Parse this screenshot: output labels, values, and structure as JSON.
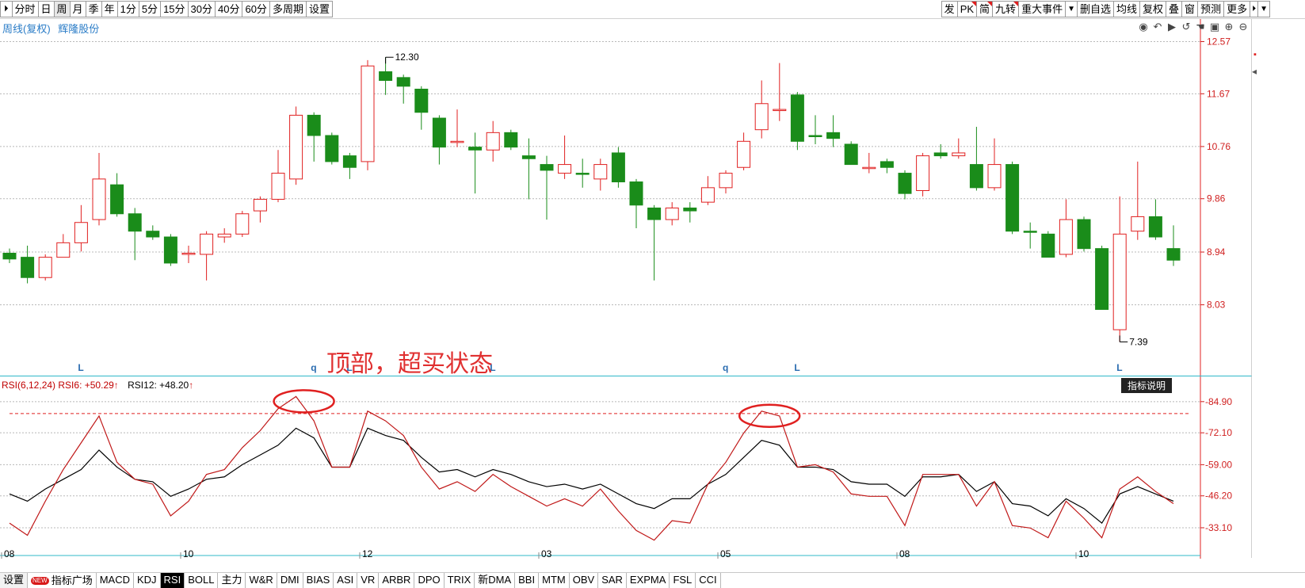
{
  "toolbar": {
    "left_icon": "⏵",
    "left_items": [
      {
        "label": "分时",
        "active": false
      },
      {
        "label": "日",
        "active": false
      },
      {
        "label": "周",
        "active": true
      },
      {
        "label": "月",
        "active": false
      },
      {
        "label": "季",
        "active": false
      },
      {
        "label": "年",
        "active": false
      },
      {
        "label": "1分",
        "active": false
      },
      {
        "label": "5分",
        "active": false
      },
      {
        "label": "15分",
        "active": false
      },
      {
        "label": "30分",
        "active": false
      },
      {
        "label": "40分",
        "active": false
      },
      {
        "label": "60分",
        "active": false
      },
      {
        "label": "多周期",
        "active": false
      },
      {
        "label": "设置",
        "active": false
      }
    ],
    "right_items": [
      "发",
      "PK",
      "简",
      "九转",
      "重大事件",
      "▼",
      "删自选",
      "均线",
      "复权",
      "叠",
      "窗",
      "预测",
      "更多",
      "⏵",
      "▼"
    ]
  },
  "chart": {
    "title_period": "周线(复权)",
    "title_stock": "辉隆股份",
    "high_label": "12.30",
    "low_label": "7.39",
    "annotation": "顶部，超买状态",
    "price_ticks": [
      "12.57",
      "11.67",
      "10.76",
      "9.86",
      "8.94",
      "8.03"
    ],
    "price_min": 7.15,
    "price_max": 12.85,
    "signal_marks": [
      {
        "label": "L",
        "index": 4
      },
      {
        "label": "q",
        "index": 17
      },
      {
        "label": "L",
        "index": 19
      },
      {
        "label": "L",
        "index": 27
      },
      {
        "label": "q",
        "index": 40
      },
      {
        "label": "L",
        "index": 44
      },
      {
        "label": "L",
        "index": 62
      }
    ],
    "colors": {
      "up": "#e02020",
      "down": "#1a8c1a",
      "rsi6": "#c01818",
      "rsi12": "#000000",
      "grid": "#b8b8b8"
    }
  },
  "rsi": {
    "legend_name": "RSI(6,12,24)",
    "rsi6_label": "RSI6:",
    "rsi6_value": "+50.29",
    "rsi12_label": "RSI12:",
    "rsi12_value": "+48.20",
    "up_arrow": "↑",
    "help_label": "指标说明",
    "ticks": [
      "84.90",
      "72.10",
      "59.00",
      "46.20",
      "33.10"
    ],
    "overbought": 80,
    "x_labels": [
      {
        "label": "08",
        "index": 0
      },
      {
        "label": "10",
        "index": 10
      },
      {
        "label": "12",
        "index": 20
      },
      {
        "label": "03",
        "index": 30
      },
      {
        "label": "05",
        "index": 40
      },
      {
        "label": "08",
        "index": 50
      },
      {
        "label": "10",
        "index": 60
      }
    ]
  },
  "chart_data": {
    "type": "candlestick",
    "title": "周线(复权) 辉隆股份",
    "candles": [
      {
        "o": 8.82,
        "c": 8.92,
        "h": 9.0,
        "l": 8.75,
        "up": false
      },
      {
        "o": 8.85,
        "c": 8.5,
        "h": 9.05,
        "l": 8.4,
        "up": false
      },
      {
        "o": 8.5,
        "c": 8.85,
        "h": 8.9,
        "l": 8.45,
        "up": true
      },
      {
        "o": 8.85,
        "c": 9.1,
        "h": 9.25,
        "l": 8.85,
        "up": true
      },
      {
        "o": 9.1,
        "c": 9.45,
        "h": 9.75,
        "l": 8.95,
        "up": true
      },
      {
        "o": 9.5,
        "c": 10.2,
        "h": 10.65,
        "l": 9.4,
        "up": true
      },
      {
        "o": 10.1,
        "c": 9.6,
        "h": 10.3,
        "l": 9.55,
        "up": false
      },
      {
        "o": 9.6,
        "c": 9.3,
        "h": 9.7,
        "l": 8.8,
        "up": false
      },
      {
        "o": 9.3,
        "c": 9.2,
        "h": 9.4,
        "l": 9.15,
        "up": false
      },
      {
        "o": 9.2,
        "c": 8.75,
        "h": 9.25,
        "l": 8.7,
        "up": false
      },
      {
        "o": 8.9,
        "c": 8.92,
        "h": 9.05,
        "l": 8.75,
        "up": true
      },
      {
        "o": 8.9,
        "c": 9.25,
        "h": 9.3,
        "l": 8.45,
        "up": true
      },
      {
        "o": 9.2,
        "c": 9.25,
        "h": 9.35,
        "l": 9.1,
        "up": true
      },
      {
        "o": 9.25,
        "c": 9.6,
        "h": 9.65,
        "l": 9.2,
        "up": true
      },
      {
        "o": 9.65,
        "c": 9.85,
        "h": 9.9,
        "l": 9.45,
        "up": true
      },
      {
        "o": 9.85,
        "c": 10.3,
        "h": 10.7,
        "l": 9.8,
        "up": true
      },
      {
        "o": 10.2,
        "c": 11.3,
        "h": 11.45,
        "l": 10.1,
        "up": true
      },
      {
        "o": 11.3,
        "c": 10.95,
        "h": 11.35,
        "l": 10.5,
        "up": false
      },
      {
        "o": 10.95,
        "c": 10.5,
        "h": 11.0,
        "l": 10.45,
        "up": false
      },
      {
        "o": 10.6,
        "c": 10.4,
        "h": 10.65,
        "l": 10.2,
        "up": false
      },
      {
        "o": 10.5,
        "c": 12.15,
        "h": 12.25,
        "l": 10.35,
        "up": true
      },
      {
        "o": 12.05,
        "c": 11.9,
        "h": 12.3,
        "l": 11.65,
        "up": false
      },
      {
        "o": 11.95,
        "c": 11.8,
        "h": 12.0,
        "l": 11.5,
        "up": false
      },
      {
        "o": 11.75,
        "c": 11.35,
        "h": 11.8,
        "l": 11.05,
        "up": false
      },
      {
        "o": 11.25,
        "c": 10.75,
        "h": 11.3,
        "l": 10.45,
        "up": false
      },
      {
        "o": 10.85,
        "c": 10.85,
        "h": 11.4,
        "l": 10.75,
        "up": true
      },
      {
        "o": 10.75,
        "c": 10.7,
        "h": 11.0,
        "l": 9.95,
        "up": false
      },
      {
        "o": 10.7,
        "c": 11.0,
        "h": 11.2,
        "l": 10.5,
        "up": true
      },
      {
        "o": 11.0,
        "c": 10.75,
        "h": 11.05,
        "l": 10.7,
        "up": false
      },
      {
        "o": 10.6,
        "c": 10.55,
        "h": 10.9,
        "l": 9.85,
        "up": false
      },
      {
        "o": 10.45,
        "c": 10.35,
        "h": 10.6,
        "l": 9.5,
        "up": false
      },
      {
        "o": 10.3,
        "c": 10.45,
        "h": 10.95,
        "l": 10.2,
        "up": true
      },
      {
        "o": 10.3,
        "c": 10.3,
        "h": 10.55,
        "l": 10.05,
        "up": false
      },
      {
        "o": 10.2,
        "c": 10.45,
        "h": 10.55,
        "l": 10.0,
        "up": true
      },
      {
        "o": 10.65,
        "c": 10.15,
        "h": 10.75,
        "l": 10.05,
        "up": false
      },
      {
        "o": 10.15,
        "c": 9.75,
        "h": 10.2,
        "l": 9.35,
        "up": false
      },
      {
        "o": 9.7,
        "c": 9.5,
        "h": 9.75,
        "l": 8.45,
        "up": false
      },
      {
        "o": 9.5,
        "c": 9.7,
        "h": 9.8,
        "l": 9.4,
        "up": true
      },
      {
        "o": 9.7,
        "c": 9.65,
        "h": 9.8,
        "l": 9.45,
        "up": false
      },
      {
        "o": 9.8,
        "c": 10.05,
        "h": 10.25,
        "l": 9.75,
        "up": true
      },
      {
        "o": 10.05,
        "c": 10.3,
        "h": 10.35,
        "l": 9.95,
        "up": true
      },
      {
        "o": 10.4,
        "c": 10.85,
        "h": 11.0,
        "l": 10.35,
        "up": true
      },
      {
        "o": 11.05,
        "c": 11.5,
        "h": 11.9,
        "l": 10.9,
        "up": true
      },
      {
        "o": 11.4,
        "c": 11.4,
        "h": 12.2,
        "l": 11.2,
        "up": true
      },
      {
        "o": 11.65,
        "c": 10.85,
        "h": 11.7,
        "l": 10.7,
        "up": false
      },
      {
        "o": 10.95,
        "c": 10.95,
        "h": 11.3,
        "l": 10.8,
        "up": false
      },
      {
        "o": 11.0,
        "c": 10.9,
        "h": 11.3,
        "l": 10.75,
        "up": false
      },
      {
        "o": 10.8,
        "c": 10.45,
        "h": 10.85,
        "l": 10.45,
        "up": false
      },
      {
        "o": 10.4,
        "c": 10.4,
        "h": 10.65,
        "l": 10.3,
        "up": true
      },
      {
        "o": 10.5,
        "c": 10.4,
        "h": 10.55,
        "l": 10.3,
        "up": false
      },
      {
        "o": 10.3,
        "c": 9.95,
        "h": 10.35,
        "l": 9.85,
        "up": false
      },
      {
        "o": 10.0,
        "c": 10.6,
        "h": 10.65,
        "l": 9.9,
        "up": true
      },
      {
        "o": 10.6,
        "c": 10.65,
        "h": 10.8,
        "l": 10.55,
        "up": false
      },
      {
        "o": 10.6,
        "c": 10.65,
        "h": 10.9,
        "l": 10.55,
        "up": true
      },
      {
        "o": 10.45,
        "c": 10.05,
        "h": 11.1,
        "l": 10.0,
        "up": false
      },
      {
        "o": 10.05,
        "c": 10.45,
        "h": 10.9,
        "l": 10.0,
        "up": true
      },
      {
        "o": 10.45,
        "c": 9.3,
        "h": 10.5,
        "l": 9.25,
        "up": false
      },
      {
        "o": 9.3,
        "c": 9.3,
        "h": 9.45,
        "l": 9.0,
        "up": false
      },
      {
        "o": 9.25,
        "c": 8.85,
        "h": 9.3,
        "l": 8.85,
        "up": false
      },
      {
        "o": 8.9,
        "c": 9.5,
        "h": 9.85,
        "l": 8.85,
        "up": true
      },
      {
        "o": 9.5,
        "c": 9.0,
        "h": 9.55,
        "l": 8.95,
        "up": false
      },
      {
        "o": 9.0,
        "c": 7.95,
        "h": 9.05,
        "l": 7.95,
        "up": false
      },
      {
        "o": 7.6,
        "c": 9.25,
        "h": 9.9,
        "l": 7.39,
        "up": true
      },
      {
        "o": 9.3,
        "c": 9.55,
        "h": 10.5,
        "l": 9.15,
        "up": true
      },
      {
        "o": 9.55,
        "c": 9.2,
        "h": 9.85,
        "l": 9.15,
        "up": false
      },
      {
        "o": 9.0,
        "c": 8.8,
        "h": 9.4,
        "l": 8.7,
        "up": false
      }
    ],
    "rsi6": [
      35,
      30,
      44,
      57,
      68,
      79,
      60,
      53,
      51,
      38,
      44,
      55,
      57,
      66,
      73,
      82,
      87,
      77,
      58,
      58,
      81,
      77,
      71,
      58,
      49,
      52,
      48,
      55,
      50,
      46,
      42,
      45,
      42,
      49,
      40,
      32,
      28,
      36,
      35,
      51,
      60,
      72,
      81,
      79,
      58,
      59,
      56,
      47,
      46,
      46,
      34,
      55,
      55,
      55,
      42,
      52,
      34,
      33,
      29,
      44,
      37,
      29,
      49,
      54,
      48,
      43
    ],
    "rsi12": [
      47,
      44,
      49,
      53,
      57,
      65,
      58,
      53,
      52,
      46,
      49,
      53,
      54,
      59,
      63,
      67,
      74,
      70,
      58,
      58,
      74,
      71,
      69,
      62,
      56,
      57,
      54,
      57,
      55,
      52,
      50,
      51,
      49,
      51,
      47,
      43,
      41,
      45,
      45,
      51,
      55,
      62,
      69,
      67,
      58,
      58,
      57,
      52,
      51,
      51,
      46,
      54,
      54,
      55,
      48,
      52,
      43,
      42,
      38,
      45,
      41,
      35,
      47,
      50,
      47,
      44
    ],
    "rsi_ylim": [
      23,
      92
    ],
    "price_ylim": [
      7.15,
      12.85
    ]
  },
  "bottom_tabs": [
    {
      "label": "设置",
      "kind": "settings"
    },
    {
      "label": "指标广场",
      "kind": "plaza",
      "badge": "NEW"
    },
    {
      "label": "MACD"
    },
    {
      "label": "KDJ"
    },
    {
      "label": "RSI",
      "active": true
    },
    {
      "label": "BOLL"
    },
    {
      "label": "主力"
    },
    {
      "label": "W&R"
    },
    {
      "label": "DMI"
    },
    {
      "label": "BIAS"
    },
    {
      "label": "ASI"
    },
    {
      "label": "VR"
    },
    {
      "label": "ARBR"
    },
    {
      "label": "DPO"
    },
    {
      "label": "TRIX"
    },
    {
      "label": "新DMA"
    },
    {
      "label": "BBI"
    },
    {
      "label": "MTM"
    },
    {
      "label": "OBV"
    },
    {
      "label": "SAR"
    },
    {
      "label": "EXPMA"
    },
    {
      "label": "FSL"
    },
    {
      "label": "CCI"
    }
  ]
}
